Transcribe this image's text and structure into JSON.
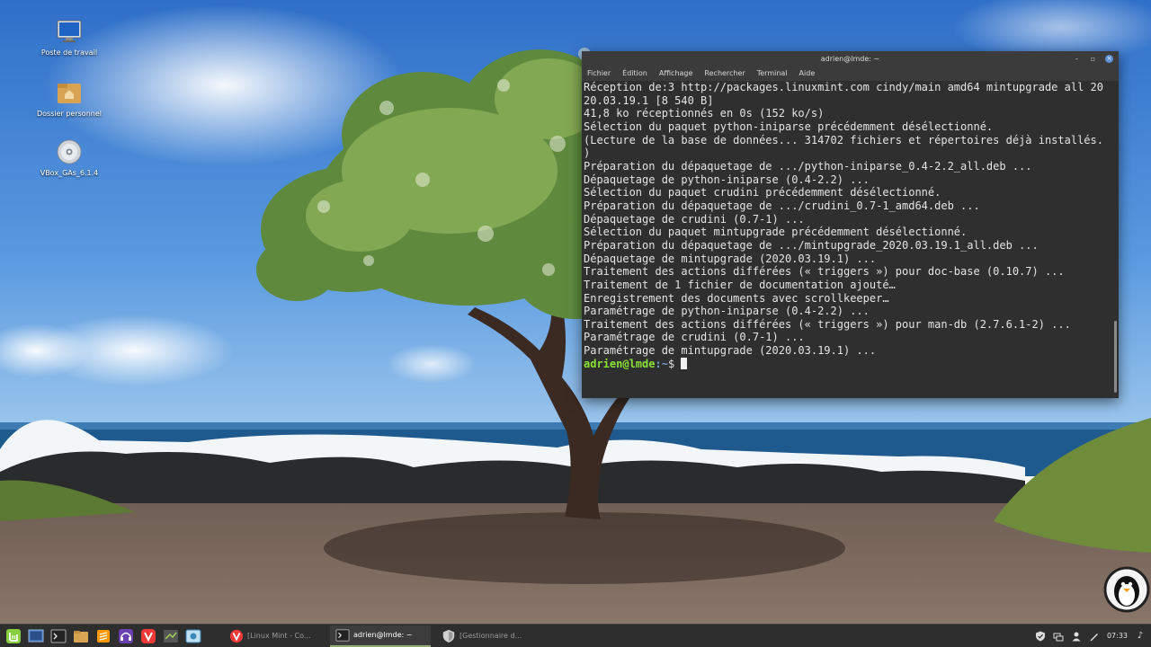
{
  "desktop": {
    "icons": [
      {
        "label": "Poste de travail",
        "icon": "computer-icon"
      },
      {
        "label": "Dossier personnel",
        "icon": "home-folder-icon"
      },
      {
        "label": "VBox_GAs_6.1.4",
        "icon": "optical-disc-icon"
      }
    ]
  },
  "terminal": {
    "title": "adrien@lmde: ~",
    "menu": [
      "Fichier",
      "Édition",
      "Affichage",
      "Rechercher",
      "Terminal",
      "Aide"
    ],
    "lines": [
      "Réception de:3 http://packages.linuxmint.com cindy/main amd64 mintupgrade all 20",
      "20.03.19.1 [8 540 B]",
      "41,8 ko réceptionnés en 0s (152 ko/s)",
      "Sélection du paquet python-iniparse précédemment désélectionné.",
      "(Lecture de la base de données... 314702 fichiers et répertoires déjà installés.",
      ")",
      "Préparation du dépaquetage de .../python-iniparse_0.4-2.2_all.deb ...",
      "Dépaquetage de python-iniparse (0.4-2.2) ...",
      "Sélection du paquet crudini précédemment désélectionné.",
      "Préparation du dépaquetage de .../crudini_0.7-1_amd64.deb ...",
      "Dépaquetage de crudini (0.7-1) ...",
      "Sélection du paquet mintupgrade précédemment désélectionné.",
      "Préparation du dépaquetage de .../mintupgrade_2020.03.19.1_all.deb ...",
      "Dépaquetage de mintupgrade (2020.03.19.1) ...",
      "Traitement des actions différées (« triggers ») pour doc-base (0.10.7) ...",
      "Traitement de 1 fichier de documentation ajouté…",
      "Enregistrement des documents avec scrollkeeper…",
      "Paramétrage de python-iniparse (0.4-2.2) ...",
      "Traitement des actions différées (« triggers ») pour man-db (2.7.6.1-2) ...",
      "Paramétrage de crudini (0.7-1) ...",
      "Paramétrage de mintupgrade (2020.03.19.1) ..."
    ],
    "prompt_user": "adrien@lmde",
    "prompt_path": ":~",
    "prompt_symbol": "$ "
  },
  "taskbar": {
    "launchers": [
      "mint-menu-icon",
      "show-desktop-icon",
      "terminal-icon",
      "files-icon",
      "sublime-icon",
      "headphones-icon",
      "vivaldi-icon",
      "synaptic-icon",
      "screenshot-icon"
    ],
    "tasks": [
      {
        "label": "[Linux Mint - Co...",
        "icon": "vivaldi-icon",
        "active": false
      },
      {
        "label": "adrien@lmde: ~",
        "icon": "terminal-icon",
        "active": true
      },
      {
        "label": "[Gestionnaire d...",
        "icon": "shield-icon",
        "active": false
      }
    ],
    "clock": "07:33"
  },
  "colors": {
    "terminal_bg": "#2f2f2f",
    "prompt_user": "#8ae234",
    "prompt_path": "#729fcf",
    "taskbar_bg": "#2e2e2e"
  }
}
